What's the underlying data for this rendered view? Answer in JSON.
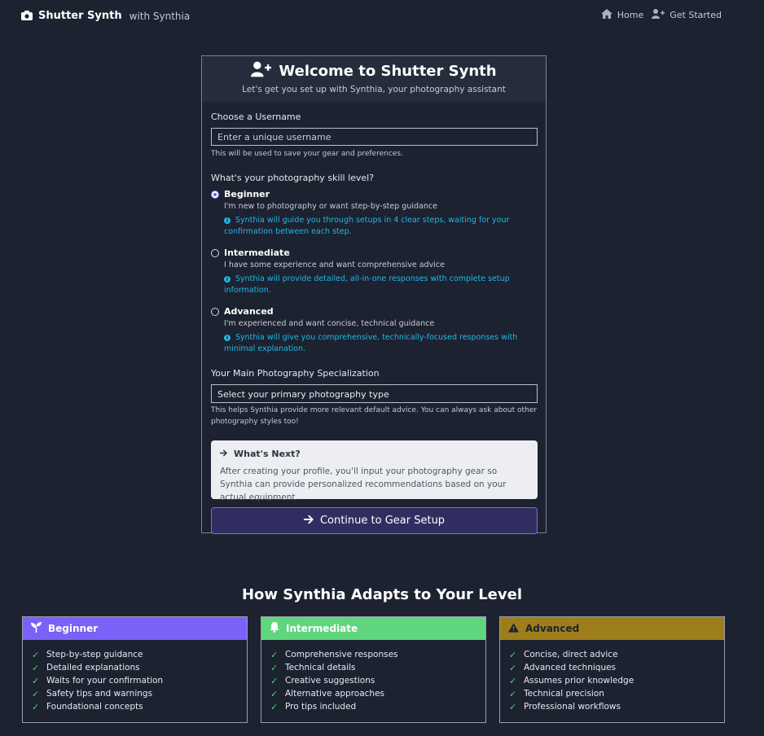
{
  "navbar": {
    "brand": "Shutter Synth",
    "brand_sub": "with Synthia",
    "links": [
      {
        "label": "Home",
        "icon": "home-icon"
      },
      {
        "label": "Get Started",
        "icon": "user-plus-icon"
      }
    ]
  },
  "card": {
    "title": "Welcome to Shutter Synth",
    "subtitle": "Let's get you set up with Synthia, your photography assistant",
    "username": {
      "label": "Choose a Username",
      "placeholder": "Enter a unique username",
      "help": "This will be used to save your gear and preferences."
    },
    "skill": {
      "label": "What's your photography skill level?",
      "options": [
        {
          "title": "Beginner",
          "checked": true,
          "desc": "I'm new to photography or want step-by-step guidance",
          "info": "Synthia will guide you through setups in 4 clear steps, waiting for your confirmation between each step."
        },
        {
          "title": "Intermediate",
          "checked": false,
          "desc": "I have some experience and want comprehensive advice",
          "info": "Synthia will provide detailed, all-in-one responses with complete setup information."
        },
        {
          "title": "Advanced",
          "checked": false,
          "desc": "I'm experienced and want concise, technical guidance",
          "info": "Synthia will give you comprehensive, technically-focused responses with minimal explanation."
        }
      ]
    },
    "specialization": {
      "label": "Your Main Photography Specialization",
      "selected": "Select your primary photography type",
      "help": "This helps Synthia provide more relevant default advice. You can always ask about other photography styles too!"
    },
    "whats_next": {
      "title": "What's Next?",
      "text": "After creating your profile, you'll input your photography gear so Synthia can provide personalized recommendations based on your actual equipment."
    },
    "continue_label": "Continue to Gear Setup"
  },
  "section": {
    "title": "How Synthia Adapts to Your Level",
    "levels": [
      {
        "name": "Beginner",
        "color": "#7b61f8",
        "text_color": "#ffffff",
        "icon": "seedling-icon",
        "items": [
          "Step-by-step guidance",
          "Detailed explanations",
          "Waits for your confirmation",
          "Safety tips and warnings",
          "Foundational concepts"
        ]
      },
      {
        "name": "Intermediate",
        "color": "#5fd67e",
        "text_color": "#ffffff",
        "icon": "bell-icon",
        "items": [
          "Comprehensive responses",
          "Technical details",
          "Creative suggestions",
          "Alternative approaches",
          "Pro tips included"
        ]
      },
      {
        "name": "Advanced",
        "color": "#9e7e1b",
        "text_color": "#1c2230",
        "icon": "warning-icon",
        "items": [
          "Concise, direct advice",
          "Advanced techniques",
          "Assumes prior knowledge",
          "Technical precision",
          "Professional workflows"
        ]
      }
    ]
  }
}
